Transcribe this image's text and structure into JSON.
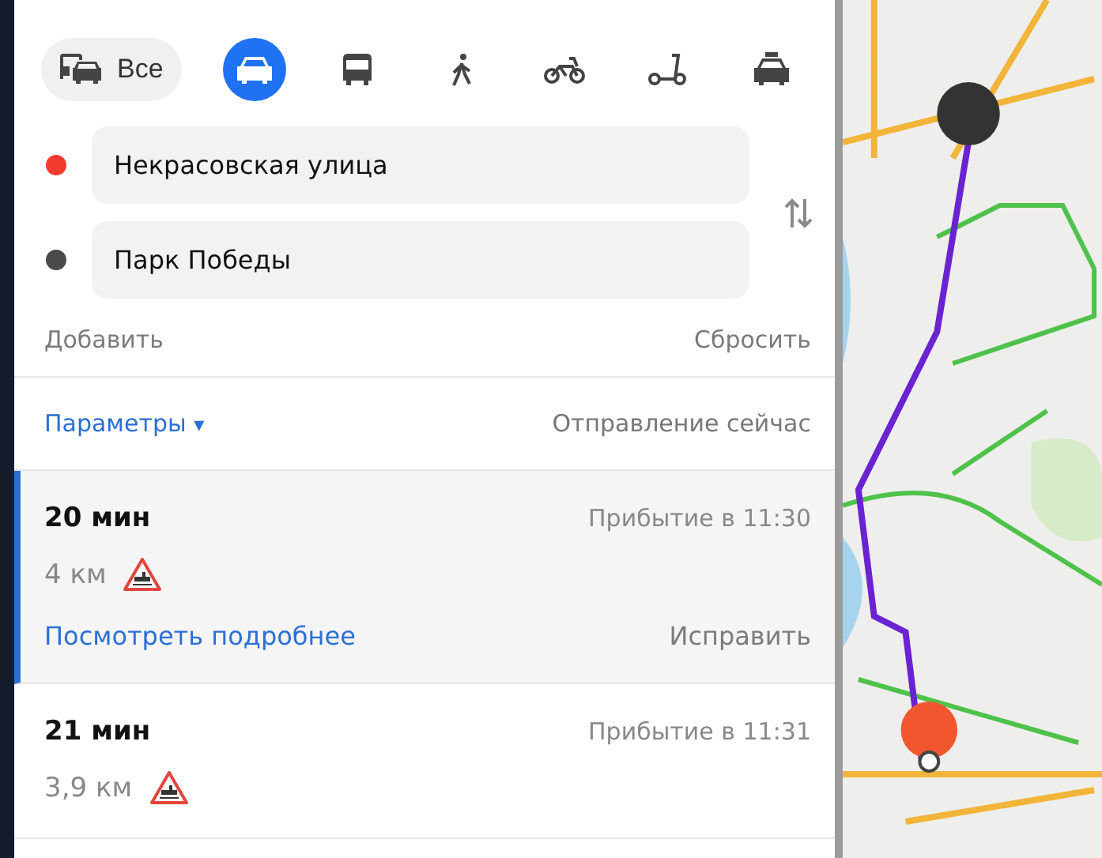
{
  "modes": [
    {
      "kind": "all",
      "label": "Все",
      "selected": false
    },
    {
      "kind": "car",
      "selected": true
    },
    {
      "kind": "bus",
      "selected": false
    },
    {
      "kind": "walk",
      "selected": false
    },
    {
      "kind": "bike",
      "selected": false
    },
    {
      "kind": "scooter",
      "selected": false
    },
    {
      "kind": "taxi",
      "selected": false
    }
  ],
  "waypoints": [
    {
      "value": "Некрасовская улица",
      "color": "#f43b2f"
    },
    {
      "value": "Парк Победы",
      "color": "#4a4a4a"
    }
  ],
  "add_link": "Добавить",
  "reset_link": "Сбросить",
  "params_link": "Параметры",
  "caret": "▾",
  "departure": "Отправление сейчас",
  "routes": [
    {
      "time": "20 мин",
      "arrival": "Прибытие в 11:30",
      "distance": "4 км",
      "crossing": true,
      "selected": true,
      "details_link": "Посмотреть подробнее",
      "fix_link": "Исправить"
    },
    {
      "time": "21 мин",
      "arrival": "Прибытие в 11:31",
      "distance": "3,9 км",
      "crossing": true,
      "selected": false
    }
  ]
}
